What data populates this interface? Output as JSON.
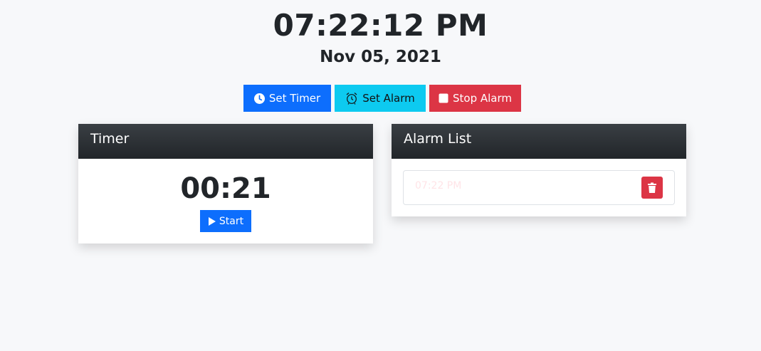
{
  "clock": {
    "time": "07:22:12 PM",
    "date": "Nov 05, 2021"
  },
  "toolbar": {
    "set_timer_label": "Set Timer",
    "set_alarm_label": "Set Alarm",
    "stop_alarm_label": "Stop Alarm"
  },
  "timer_card": {
    "title": "Timer",
    "display": "00:21",
    "start_label": "Start"
  },
  "alarm_card": {
    "title": "Alarm List",
    "alarms": [
      {
        "time": "07:22 PM"
      }
    ]
  },
  "colors": {
    "primary": "#0d6efd",
    "info": "#0dcaf0",
    "danger": "#dc3545",
    "dark": "#212529",
    "background": "#f7f8fa"
  },
  "icons": {
    "set_timer": "clock-icon",
    "set_alarm": "alarm-clock-icon",
    "stop_alarm": "stop-icon",
    "start": "play-icon",
    "delete": "trash-icon"
  }
}
